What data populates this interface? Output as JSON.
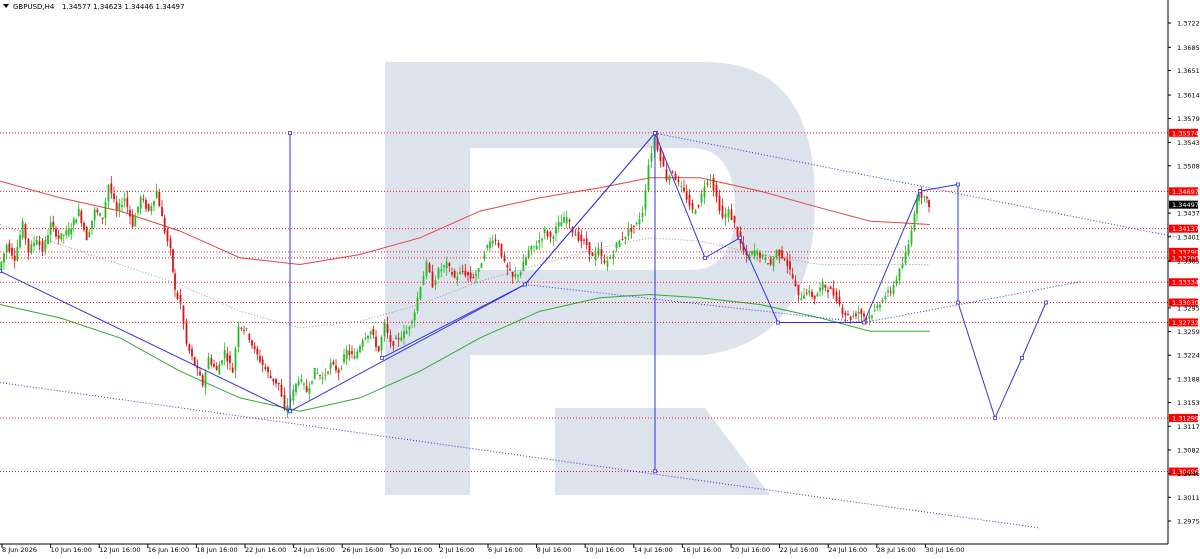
{
  "header": {
    "symbol": "GBPUSD,H4",
    "ohlc": "1.34577 1.34623 1.34446 1.34497"
  },
  "colors": {
    "bull": "#22bb22",
    "bear": "#dd1111",
    "blue": "#3333dd",
    "red_level": "#ee2222",
    "ma_red": "#e04444",
    "ma_green": "#33aa33",
    "watermark": "#dde3ec",
    "price_tag": "#ff0000",
    "current_tag": "#000000"
  },
  "chart_data": {
    "type": "candlestick",
    "symbol": "GBPUSD",
    "timeframe": "H4",
    "ylim": [
      1.2941,
      1.3755
    ],
    "y_ticks": [
      "1.37220",
      "1.36855",
      "1.36510",
      "1.36140",
      "1.35790",
      "1.35430",
      "1.35080",
      "1.34370",
      "1.34015",
      "1.33650",
      "1.32950",
      "1.32595",
      "1.32240",
      "1.31885",
      "1.31530",
      "1.31175",
      "1.30820",
      "1.30465",
      "1.30110",
      "1.29755"
    ],
    "x_ticks": [
      "8 Jun 2026",
      "10 Jun 16:00",
      "12 Jun 16:00",
      "16 Jun 16:00",
      "18 Jun 16:00",
      "22 Jun 16:00",
      "24 Jun 16:00",
      "26 Jun 16:00",
      "30 Jun 16:00",
      "2 Jul 16:00",
      "6 Jul 16:00",
      "8 Jul 16:00",
      "10 Jul 16:00",
      "14 Jul 16:00",
      "16 Jul 16:00",
      "20 Jul 16:00",
      "22 Jul 16:00",
      "24 Jul 16:00",
      "28 Jul 16:00",
      "30 Jul 16:00"
    ],
    "levels": [
      {
        "price": 1.35574,
        "label": "1.35574"
      },
      {
        "price": 1.34697,
        "label": "1.34697"
      },
      {
        "price": 1.34137,
        "label": "1.34137"
      },
      {
        "price": 1.3379,
        "label": "1.33790"
      },
      {
        "price": 1.337,
        "label": "1.33700"
      },
      {
        "price": 1.33334,
        "label": "1.33334"
      },
      {
        "price": 1.3303,
        "label": "1.33030"
      },
      {
        "price": 1.32732,
        "label": "1.32732"
      },
      {
        "price": 1.31299,
        "label": "1.31299"
      },
      {
        "price": 1.30496,
        "label": "1.30496"
      }
    ],
    "current_price": {
      "price": 1.34497,
      "label": "1.34497"
    },
    "price_path": [
      [
        0,
        1.335
      ],
      [
        8,
        1.339
      ],
      [
        16,
        1.337
      ],
      [
        24,
        1.342
      ],
      [
        30,
        1.338
      ],
      [
        38,
        1.34
      ],
      [
        44,
        1.338
      ],
      [
        52,
        1.342
      ],
      [
        60,
        1.34
      ],
      [
        70,
        1.341
      ],
      [
        80,
        1.344
      ],
      [
        88,
        1.34
      ],
      [
        96,
        1.344
      ],
      [
        104,
        1.343
      ],
      [
        110,
        1.348
      ],
      [
        118,
        1.344
      ],
      [
        126,
        1.346
      ],
      [
        134,
        1.342
      ],
      [
        142,
        1.346
      ],
      [
        150,
        1.344
      ],
      [
        158,
        1.347
      ],
      [
        166,
        1.341
      ],
      [
        172,
        1.338
      ],
      [
        176,
        1.332
      ],
      [
        182,
        1.33
      ],
      [
        188,
        1.324
      ],
      [
        196,
        1.321
      ],
      [
        204,
        1.318
      ],
      [
        210,
        1.322
      ],
      [
        218,
        1.32
      ],
      [
        226,
        1.323
      ],
      [
        234,
        1.32
      ],
      [
        240,
        1.327
      ],
      [
        248,
        1.326
      ],
      [
        256,
        1.323
      ],
      [
        264,
        1.321
      ],
      [
        272,
        1.319
      ],
      [
        280,
        1.318
      ],
      [
        286,
        1.314
      ],
      [
        292,
        1.316
      ],
      [
        300,
        1.319
      ],
      [
        308,
        1.317
      ],
      [
        316,
        1.32
      ],
      [
        324,
        1.319
      ],
      [
        332,
        1.321
      ],
      [
        340,
        1.32
      ],
      [
        348,
        1.323
      ],
      [
        356,
        1.322
      ],
      [
        364,
        1.325
      ],
      [
        372,
        1.326
      ],
      [
        380,
        1.323
      ],
      [
        386,
        1.327
      ],
      [
        392,
        1.324
      ],
      [
        400,
        1.325
      ],
      [
        408,
        1.326
      ],
      [
        416,
        1.329
      ],
      [
        422,
        1.333
      ],
      [
        428,
        1.336
      ],
      [
        434,
        1.333
      ],
      [
        440,
        1.335
      ],
      [
        448,
        1.336
      ],
      [
        456,
        1.334
      ],
      [
        464,
        1.335
      ],
      [
        472,
        1.334
      ],
      [
        480,
        1.335
      ],
      [
        486,
        1.338
      ],
      [
        494,
        1.34
      ],
      [
        500,
        1.339
      ],
      [
        506,
        1.336
      ],
      [
        514,
        1.334
      ],
      [
        522,
        1.335
      ],
      [
        530,
        1.338
      ],
      [
        538,
        1.339
      ],
      [
        546,
        1.341
      ],
      [
        552,
        1.34
      ],
      [
        560,
        1.342
      ],
      [
        568,
        1.343
      ],
      [
        574,
        1.341
      ],
      [
        580,
        1.34
      ],
      [
        588,
        1.339
      ],
      [
        594,
        1.337
      ],
      [
        600,
        1.338
      ],
      [
        606,
        1.336
      ],
      [
        612,
        1.337
      ],
      [
        618,
        1.339
      ],
      [
        624,
        1.34
      ],
      [
        630,
        1.341
      ],
      [
        638,
        1.342
      ],
      [
        644,
        1.344
      ],
      [
        650,
        1.351
      ],
      [
        656,
        1.355
      ],
      [
        662,
        1.352
      ],
      [
        668,
        1.349
      ],
      [
        674,
        1.35
      ],
      [
        680,
        1.348
      ],
      [
        688,
        1.346
      ],
      [
        694,
        1.344
      ],
      [
        700,
        1.345
      ],
      [
        706,
        1.348
      ],
      [
        712,
        1.349
      ],
      [
        718,
        1.346
      ],
      [
        724,
        1.343
      ],
      [
        730,
        1.344
      ],
      [
        736,
        1.342
      ],
      [
        742,
        1.339
      ],
      [
        748,
        1.337
      ],
      [
        756,
        1.338
      ],
      [
        764,
        1.337
      ],
      [
        772,
        1.336
      ],
      [
        778,
        1.338
      ],
      [
        786,
        1.337
      ],
      [
        794,
        1.334
      ],
      [
        800,
        1.331
      ],
      [
        808,
        1.332
      ],
      [
        816,
        1.331
      ],
      [
        824,
        1.333
      ],
      [
        832,
        1.332
      ],
      [
        838,
        1.331
      ],
      [
        844,
        1.329
      ],
      [
        852,
        1.328
      ],
      [
        860,
        1.329
      ],
      [
        868,
        1.328
      ],
      [
        876,
        1.329
      ],
      [
        884,
        1.331
      ],
      [
        892,
        1.332
      ],
      [
        898,
        1.334
      ],
      [
        904,
        1.336
      ],
      [
        910,
        1.339
      ],
      [
        916,
        1.344
      ],
      [
        920,
        1.347
      ],
      [
        926,
        1.346
      ],
      [
        930,
        1.345
      ]
    ],
    "moving_averages": {
      "red": [
        [
          0,
          1.3485
        ],
        [
          60,
          1.346
        ],
        [
          120,
          1.344
        ],
        [
          180,
          1.341
        ],
        [
          240,
          1.337
        ],
        [
          300,
          1.336
        ],
        [
          360,
          1.3375
        ],
        [
          420,
          1.34
        ],
        [
          480,
          1.344
        ],
        [
          540,
          1.346
        ],
        [
          600,
          1.3475
        ],
        [
          650,
          1.349
        ],
        [
          700,
          1.349
        ],
        [
          760,
          1.347
        ],
        [
          820,
          1.3445
        ],
        [
          870,
          1.3425
        ],
        [
          930,
          1.342
        ]
      ],
      "green": [
        [
          0,
          1.33
        ],
        [
          60,
          1.328
        ],
        [
          120,
          1.325
        ],
        [
          180,
          1.32
        ],
        [
          240,
          1.316
        ],
        [
          300,
          1.314
        ],
        [
          360,
          1.316
        ],
        [
          420,
          1.32
        ],
        [
          480,
          1.325
        ],
        [
          540,
          1.329
        ],
        [
          600,
          1.331
        ],
        [
          650,
          1.3315
        ],
        [
          700,
          1.331
        ],
        [
          760,
          1.33
        ],
        [
          820,
          1.328
        ],
        [
          870,
          1.326
        ],
        [
          930,
          1.326
        ]
      ],
      "gray": [
        [
          0,
          1.342
        ],
        [
          60,
          1.339
        ],
        [
          120,
          1.336
        ],
        [
          180,
          1.333
        ],
        [
          240,
          1.329
        ],
        [
          300,
          1.3265
        ],
        [
          360,
          1.3275
        ],
        [
          420,
          1.33
        ],
        [
          480,
          1.3335
        ],
        [
          540,
          1.336
        ],
        [
          600,
          1.3385
        ],
        [
          650,
          1.34
        ],
        [
          700,
          1.3395
        ],
        [
          760,
          1.3375
        ],
        [
          820,
          1.336
        ],
        [
          870,
          1.336
        ],
        [
          930,
          1.336
        ]
      ]
    },
    "forecast_polyline": [
      [
        920,
        1.347
      ],
      [
        958,
        1.348
      ],
      [
        958,
        1.3303
      ],
      [
        995,
        1.313
      ],
      [
        1022,
        1.322
      ],
      [
        1046,
        1.3303
      ]
    ],
    "waves": [
      [
        [
          0,
          1.335
        ],
        [
          290,
          1.314
        ],
        [
          525,
          1.333
        ],
        [
          655,
          1.3557
        ],
        [
          705,
          1.337
        ],
        [
          740,
          1.34
        ],
        [
          778,
          1.3273
        ],
        [
          864,
          1.3273
        ],
        [
          920,
          1.347
        ]
      ],
      [
        [
          382,
          1.322
        ],
        [
          525,
          1.333
        ],
        [
          655,
          1.3557
        ]
      ]
    ],
    "vertical_markers": [
      [
        290,
        1.3557,
        1.314
      ],
      [
        655,
        1.3557,
        1.305
      ]
    ],
    "channels": [
      [
        [
          655,
          1.3557
        ],
        [
          1180,
          1.34
        ]
      ],
      [
        [
          525,
          1.333
        ],
        [
          864,
          1.3273
        ]
      ],
      [
        [
          864,
          1.3273
        ],
        [
          1080,
          1.3334
        ]
      ],
      [
        [
          0,
          1.3183
        ],
        [
          1040,
          1.2965
        ]
      ]
    ]
  }
}
